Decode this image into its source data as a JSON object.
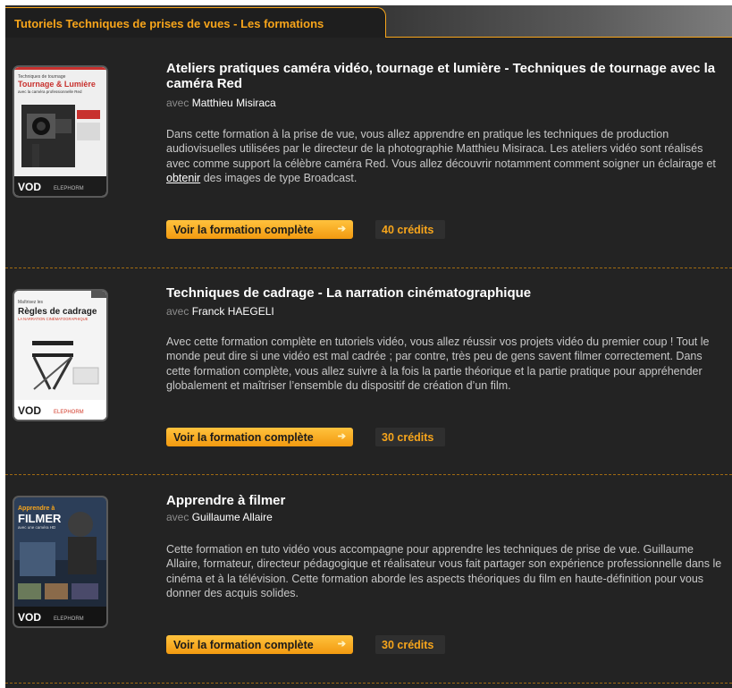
{
  "header": {
    "title": "Tutoriels Techniques de prises de vues - Les formations"
  },
  "courses": [
    {
      "title": "Ateliers pratiques caméra vidéo, tournage et lumière - Techniques de tournage avec la caméra Red",
      "author_prefix": "avec",
      "author": "Matthieu Misiraca",
      "desc_before": "Dans cette formation à la prise de vue, vous allez apprendre en pratique les techniques de production audiovisuelles utilisées par le directeur de la photographie Matthieu Misiraca. Les ateliers vidéo sont réalisés avec comme support la célèbre caméra Red. Vous allez découvrir notamment comment soigner un éclairage et ",
      "desc_link": "obtenir",
      "desc_after": " des images de type Broadcast.",
      "button": "Voir la formation complète",
      "credits": "40 crédits",
      "cover": {
        "top_line": "Techniques de tournage",
        "title_line1": "Tournage & Lumière",
        "title_line2": "avec la caméra professionnelle Red",
        "vod": "VOD",
        "brand": "ELEPHORM",
        "color": "#c8312e"
      }
    },
    {
      "title": "Techniques de cadrage - La narration cinématographique",
      "author_prefix": "avec",
      "author": "Franck HAEGELI",
      "desc_before": "Avec cette formation complète en tutoriels vidéo, vous allez réussir vos projets vidéo du premier coup ! Tout le monde peut dire si une vidéo est mal cadrée ; par contre, très peu de gens savent filmer correctement. Dans cette formation complète, vous allez suivre à la fois la partie théorique et la partie pratique pour appréhender globalement et maîtriser l’ensemble du dispositif de création d’un film.",
      "desc_link": "",
      "desc_after": "",
      "button": "Voir la formation complète",
      "credits": "30 crédits",
      "cover": {
        "top_line": "Maîtrisez les",
        "title_line1": "Règles de cadrage",
        "title_line2": "LA NARRATION CINÉMATOGRAPHIQUE",
        "vod": "VOD",
        "brand": "ELEPHORM",
        "color": "#d23a2a"
      }
    },
    {
      "title": "Apprendre à filmer",
      "author_prefix": "avec",
      "author": "Guillaume Allaire",
      "desc_before": "Cette formation en tuto vidéo vous accompagne pour apprendre les techniques de prise de vue. Guillaume Allaire, formateur, directeur pédagogique et réalisateur vous fait partager son expérience professionnelle dans le cinéma et à la télévision. Cette formation aborde les aspects théoriques du film en haute-définition pour vous donner des acquis solides.",
      "desc_link": "",
      "desc_after": "",
      "button": "Voir la formation complète",
      "credits": "30 crédits",
      "cover": {
        "top_line": "Apprendre à",
        "title_line1": "FILMER",
        "title_line2": "avec une caméra HD",
        "vod": "VOD",
        "brand": "ELEPHORM",
        "color": "#e07a12"
      }
    }
  ],
  "colors": {
    "accent": "#f7a51b",
    "background": "#232323",
    "text": "#c8c8c8"
  }
}
